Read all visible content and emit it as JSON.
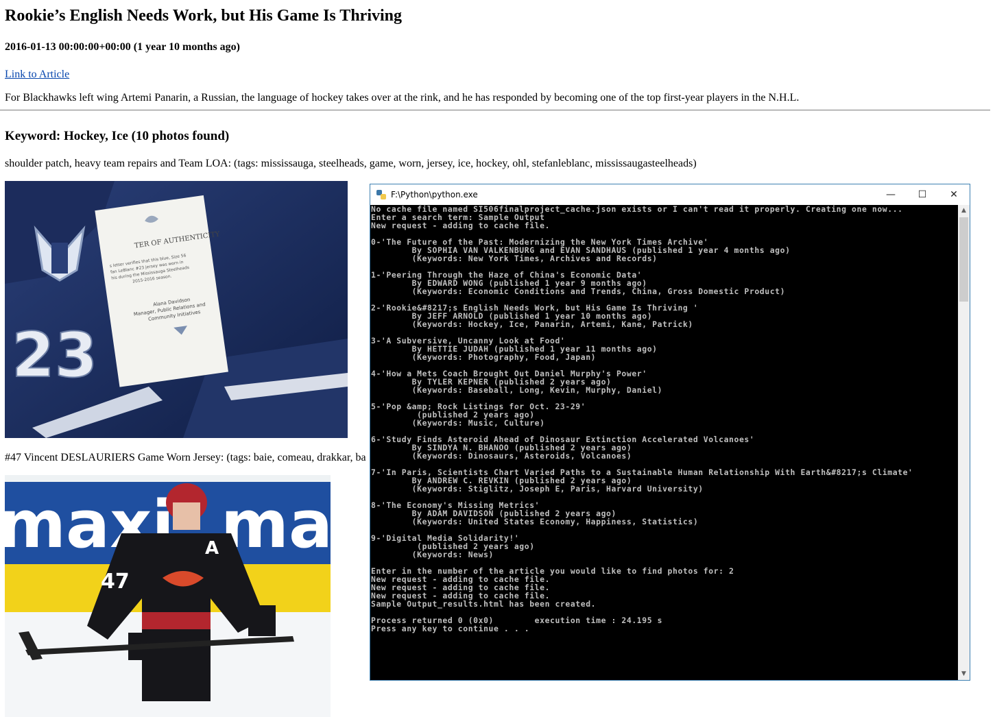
{
  "article": {
    "title": "Rookie’s English Needs Work, but His Game Is Thriving",
    "date": "2016-01-13 00:00:00+00:00 (1 year 10 months ago)",
    "link_text": "Link to Article",
    "summary": "For Blackhawks left wing Artemi Panarin, a Russian, the language of hockey takes over at the rink, and he has responded by becoming one of the top first-year players in the N.H.L."
  },
  "keyword_heading": "Keyword: Hockey, Ice (10 photos found)",
  "photos": [
    {
      "caption": "shoulder patch, heavy team repairs and Team LOA: (tags: mississauga, steelheads, game, worn, jersey, ice, hockey, ohl, stefanleblanc, mississaugasteelheads)",
      "card_heading": "TER OF AUTHENTICITY",
      "card_lines": [
        "s letter verifies that this blue, Size 56",
        "fan LeBlanc #23 jersey was worn in",
        "his during the Mississauga Steelheads",
        "2015-2016 season."
      ],
      "card_sign": [
        "Alana Davidson",
        "Manager, Public Relations and",
        "Community Initiatives"
      ],
      "jersey_number": "23"
    },
    {
      "caption": "#47 Vincent DESLAURIERS Game Worn Jersey: (tags: baie, comeau, drakkar, ba",
      "board_text": "maxi",
      "board_text2": "ma",
      "player_number": "47",
      "captain_letter": "A"
    }
  ],
  "console": {
    "title": "F:\\Python\\python.exe",
    "min_glyph": "—",
    "max_glyph": "☐",
    "close_glyph": "✕",
    "lines": [
      "No cache file named SI506finalproject_cache.json exists or I can't read it properly. Creating one now...",
      "Enter a search term: Sample Output",
      "New request - adding to cache file.",
      "",
      "0-'The Future of the Past: Modernizing the New York Times Archive'",
      "        By SOPHIA VAN VALKENBURG and EVAN SANDHAUS (published 1 year 4 months ago)",
      "        (Keywords: New York Times, Archives and Records)",
      "",
      "1-'Peering Through the Haze of China's Economic Data'",
      "        By EDWARD WONG (published 1 year 9 months ago)",
      "        (Keywords: Economic Conditions and Trends, China, Gross Domestic Product)",
      "",
      "2-'Rookie&#8217;s English Needs Work, but His Game Is Thriving '",
      "        By JEFF ARNOLD (published 1 year 10 months ago)",
      "        (Keywords: Hockey, Ice, Panarin, Artemi, Kane, Patrick)",
      "",
      "3-'A Subversive, Uncanny Look at Food'",
      "        By HETTIE JUDAH (published 1 year 11 months ago)",
      "        (Keywords: Photography, Food, Japan)",
      "",
      "4-'How a Mets Coach Brought Out Daniel Murphy's Power'",
      "        By TYLER KEPNER (published 2 years ago)",
      "        (Keywords: Baseball, Long, Kevin, Murphy, Daniel)",
      "",
      "5-'Pop &amp; Rock Listings for Oct. 23-29'",
      "         (published 2 years ago)",
      "        (Keywords: Music, Culture)",
      "",
      "6-'Study Finds Asteroid Ahead of Dinosaur Extinction Accelerated Volcanoes'",
      "        By SINDYA N. BHANOO (published 2 years ago)",
      "        (Keywords: Dinosaurs, Asteroids, Volcanoes)",
      "",
      "7-'In Paris, Scientists Chart Varied Paths to a Sustainable Human Relationship With Earth&#8217;s Climate'",
      "        By ANDREW C. REVKIN (published 2 years ago)",
      "        (Keywords: Stiglitz, Joseph E, Paris, Harvard University)",
      "",
      "8-'The Economy's Missing Metrics'",
      "        By ADAM DAVIDSON (published 2 years ago)",
      "        (Keywords: United States Economy, Happiness, Statistics)",
      "",
      "9-'Digital Media Solidarity!'",
      "         (published 2 years ago)",
      "        (Keywords: News)",
      "",
      "Enter in the number of the article you would like to find photos for: 2",
      "New request - adding to cache file.",
      "New request - adding to cache file.",
      "New request - adding to cache file.",
      "Sample Output_results.html has been created.",
      "",
      "Process returned 0 (0x0)        execution time : 24.195 s",
      "Press any key to continue . . ."
    ]
  }
}
